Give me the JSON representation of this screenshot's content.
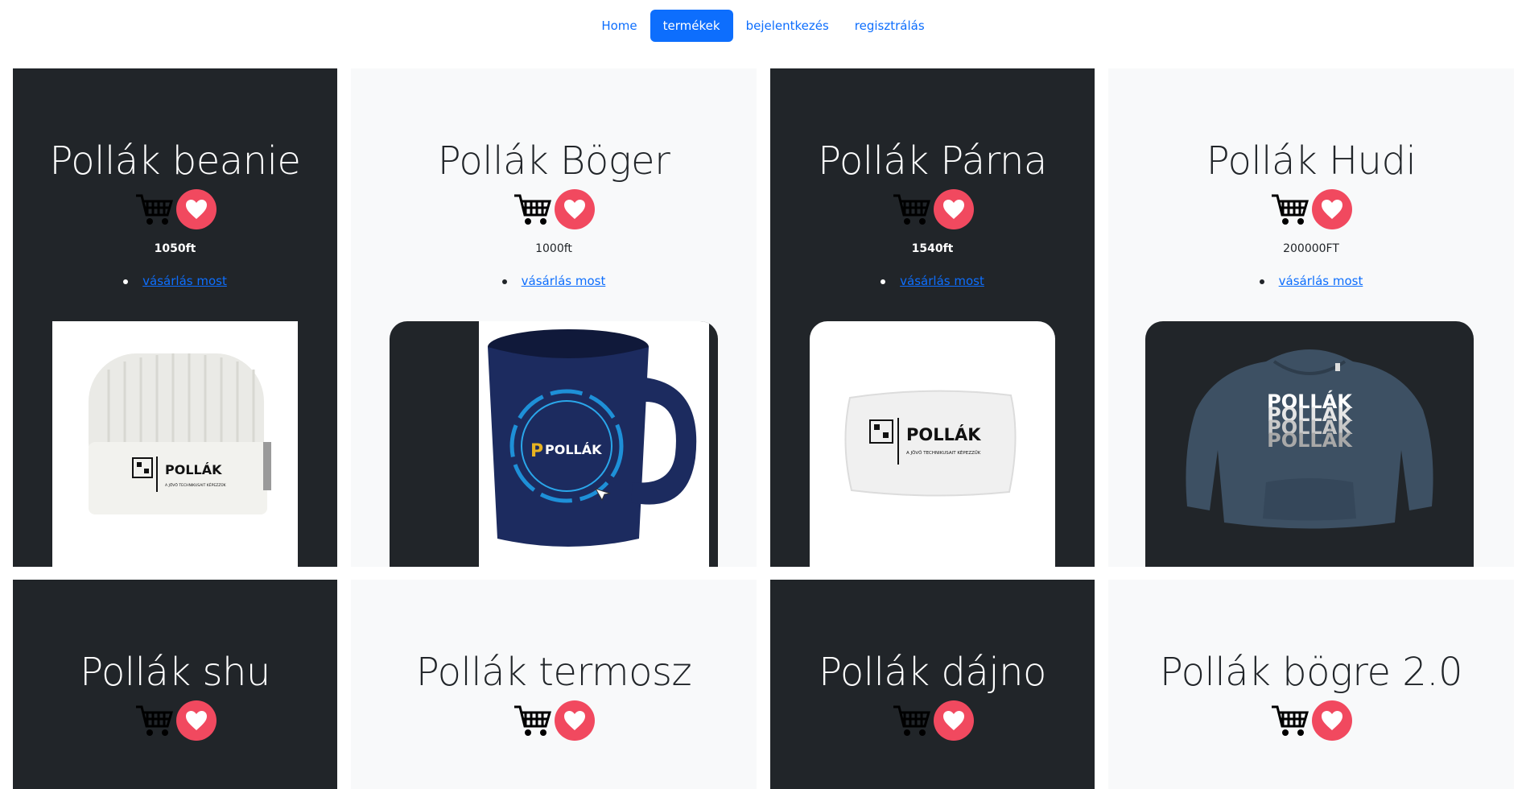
{
  "nav": {
    "items": [
      {
        "label": "Home"
      },
      {
        "label": "termékek"
      },
      {
        "label": "bejelentkezés"
      },
      {
        "label": "regisztrálás"
      }
    ]
  },
  "products": [
    {
      "name": "Pollák beanie",
      "price": "1050ft",
      "buy_label": "vásárlás most",
      "image_label": "POLLÁK",
      "image_tagline": "A JÖVŐ TECHNIKUSAIT KÉPEZZÜK"
    },
    {
      "name": "Pollák Böger",
      "price": "1000ft",
      "buy_label": "vásárlás most",
      "image_label": "POLLÁK"
    },
    {
      "name": "Pollák Párna",
      "price": "1540ft",
      "buy_label": "vásárlás most",
      "image_label": "POLLÁK",
      "image_tagline": "A JÖVŐ TECHNIKUSAIT KÉPEZZÜK"
    },
    {
      "name": "Pollák Hudi",
      "price": "200000FT",
      "buy_label": "vásárlás most",
      "image_label": "POLLÁK"
    },
    {
      "name": "Pollák shu"
    },
    {
      "name": "Pollák termosz"
    },
    {
      "name": "Pollák dájno"
    },
    {
      "name": "Pollák bögre 2.0"
    }
  ],
  "icons": {
    "cart": "cart-icon",
    "heart": "heart-icon"
  },
  "colors": {
    "accent": "#0d6efd",
    "dark_card": "#212529",
    "light_card": "#f8f9fa",
    "heart": "#f1495f"
  }
}
